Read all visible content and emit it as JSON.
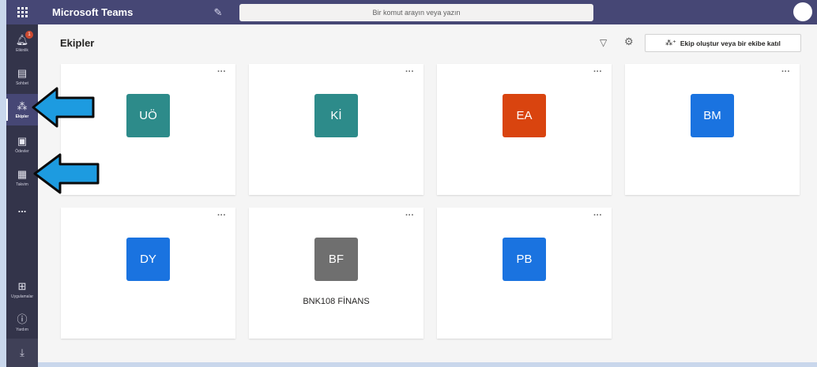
{
  "topbar": {
    "app_title": "Microsoft Teams",
    "search_placeholder": "Bir komut arayın veya yazın"
  },
  "rail": {
    "items": [
      {
        "label": "Etkinlik",
        "icon": "bell-icon",
        "badge": "1"
      },
      {
        "label": "Sohbet",
        "icon": "chat-icon"
      },
      {
        "label": "Ekipler",
        "icon": "teams-icon",
        "active": true
      },
      {
        "label": "Ödevler",
        "icon": "assignments-icon"
      },
      {
        "label": "Takvim",
        "icon": "calendar-icon"
      },
      {
        "label": "...",
        "icon": "more-icon"
      },
      {
        "label": "Uygulamalar",
        "icon": "apps-icon"
      },
      {
        "label": "Yardım",
        "icon": "help-icon"
      }
    ]
  },
  "main": {
    "title": "Ekipler",
    "create_button": "Ekip oluştur veya bir ekibe katıl"
  },
  "teams": [
    {
      "initials": "UÖ",
      "color": "#2d8b8a",
      "name": ""
    },
    {
      "initials": "Kİ",
      "color": "#2d8b8a",
      "name": ""
    },
    {
      "initials": "EA",
      "color": "#d9440f",
      "name": ""
    },
    {
      "initials": "BM",
      "color": "#1a73e0",
      "name": ""
    },
    {
      "initials": "DY",
      "color": "#1a73e0",
      "name": ""
    },
    {
      "initials": "BF",
      "color": "#6f6f6f",
      "name": "BNK108 FİNANS"
    },
    {
      "initials": "PB",
      "color": "#1a73e0",
      "name": ""
    }
  ],
  "colors": {
    "topbar": "#464775",
    "rail": "#33344a",
    "arrow_fill": "#1d9be0"
  }
}
